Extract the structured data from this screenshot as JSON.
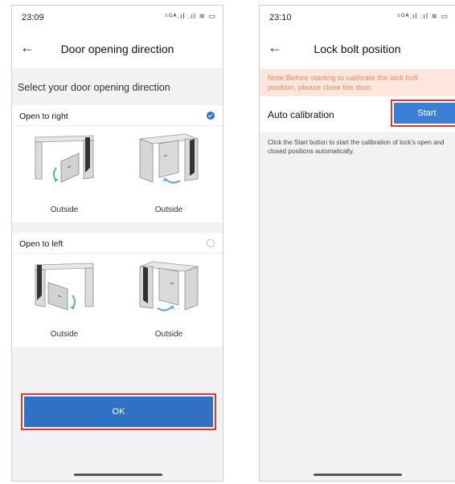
{
  "screen1": {
    "status": {
      "time": "23:09",
      "icons": "⁵ᴳᴬ.ıl .ıl ≋ ▭"
    },
    "nav": {
      "back_icon": "arrow-left-icon",
      "title": "Door opening direction"
    },
    "prompt": "Select your door opening direction",
    "options": [
      {
        "label": "Open to right",
        "selected": true,
        "captions": [
          "Outside",
          "Outside"
        ]
      },
      {
        "label": "Open to left",
        "selected": false,
        "captions": [
          "Outside",
          "Outside"
        ]
      }
    ],
    "ok_label": "OK"
  },
  "screen2": {
    "status": {
      "time": "23:10",
      "icons": "⁵ᴳᴬ.ıl .ıl ≋ ▭"
    },
    "nav": {
      "back_icon": "arrow-left-icon",
      "title": "Lock bolt position"
    },
    "note": "Note:Before starting to calibrate the lock bolt position, please close the door.",
    "auto_label": "Auto calibration",
    "start_label": "Start",
    "description": "Click the Start button to start the calibration of lock's open and closed positions automatically."
  },
  "colors": {
    "accent": "#3071c4",
    "highlight": "#d93a2b",
    "note_bg": "#fde6dc",
    "note_text": "#f08a5d",
    "page_bg": "#f2f2f4"
  }
}
